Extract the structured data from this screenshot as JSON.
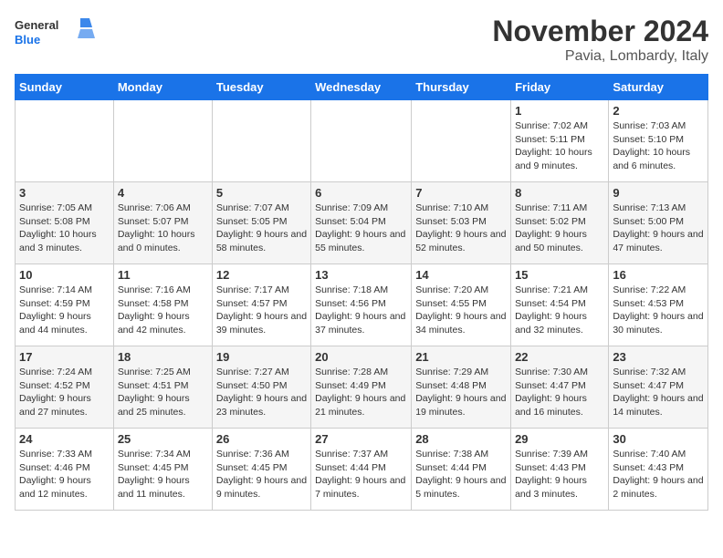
{
  "header": {
    "logo_line1": "General",
    "logo_line2": "Blue",
    "month_year": "November 2024",
    "location": "Pavia, Lombardy, Italy"
  },
  "weekdays": [
    "Sunday",
    "Monday",
    "Tuesday",
    "Wednesday",
    "Thursday",
    "Friday",
    "Saturday"
  ],
  "weeks": [
    [
      {
        "day": "",
        "info": ""
      },
      {
        "day": "",
        "info": ""
      },
      {
        "day": "",
        "info": ""
      },
      {
        "day": "",
        "info": ""
      },
      {
        "day": "",
        "info": ""
      },
      {
        "day": "1",
        "info": "Sunrise: 7:02 AM\nSunset: 5:11 PM\nDaylight: 10 hours and 9 minutes."
      },
      {
        "day": "2",
        "info": "Sunrise: 7:03 AM\nSunset: 5:10 PM\nDaylight: 10 hours and 6 minutes."
      }
    ],
    [
      {
        "day": "3",
        "info": "Sunrise: 7:05 AM\nSunset: 5:08 PM\nDaylight: 10 hours and 3 minutes."
      },
      {
        "day": "4",
        "info": "Sunrise: 7:06 AM\nSunset: 5:07 PM\nDaylight: 10 hours and 0 minutes."
      },
      {
        "day": "5",
        "info": "Sunrise: 7:07 AM\nSunset: 5:05 PM\nDaylight: 9 hours and 58 minutes."
      },
      {
        "day": "6",
        "info": "Sunrise: 7:09 AM\nSunset: 5:04 PM\nDaylight: 9 hours and 55 minutes."
      },
      {
        "day": "7",
        "info": "Sunrise: 7:10 AM\nSunset: 5:03 PM\nDaylight: 9 hours and 52 minutes."
      },
      {
        "day": "8",
        "info": "Sunrise: 7:11 AM\nSunset: 5:02 PM\nDaylight: 9 hours and 50 minutes."
      },
      {
        "day": "9",
        "info": "Sunrise: 7:13 AM\nSunset: 5:00 PM\nDaylight: 9 hours and 47 minutes."
      }
    ],
    [
      {
        "day": "10",
        "info": "Sunrise: 7:14 AM\nSunset: 4:59 PM\nDaylight: 9 hours and 44 minutes."
      },
      {
        "day": "11",
        "info": "Sunrise: 7:16 AM\nSunset: 4:58 PM\nDaylight: 9 hours and 42 minutes."
      },
      {
        "day": "12",
        "info": "Sunrise: 7:17 AM\nSunset: 4:57 PM\nDaylight: 9 hours and 39 minutes."
      },
      {
        "day": "13",
        "info": "Sunrise: 7:18 AM\nSunset: 4:56 PM\nDaylight: 9 hours and 37 minutes."
      },
      {
        "day": "14",
        "info": "Sunrise: 7:20 AM\nSunset: 4:55 PM\nDaylight: 9 hours and 34 minutes."
      },
      {
        "day": "15",
        "info": "Sunrise: 7:21 AM\nSunset: 4:54 PM\nDaylight: 9 hours and 32 minutes."
      },
      {
        "day": "16",
        "info": "Sunrise: 7:22 AM\nSunset: 4:53 PM\nDaylight: 9 hours and 30 minutes."
      }
    ],
    [
      {
        "day": "17",
        "info": "Sunrise: 7:24 AM\nSunset: 4:52 PM\nDaylight: 9 hours and 27 minutes."
      },
      {
        "day": "18",
        "info": "Sunrise: 7:25 AM\nSunset: 4:51 PM\nDaylight: 9 hours and 25 minutes."
      },
      {
        "day": "19",
        "info": "Sunrise: 7:27 AM\nSunset: 4:50 PM\nDaylight: 9 hours and 23 minutes."
      },
      {
        "day": "20",
        "info": "Sunrise: 7:28 AM\nSunset: 4:49 PM\nDaylight: 9 hours and 21 minutes."
      },
      {
        "day": "21",
        "info": "Sunrise: 7:29 AM\nSunset: 4:48 PM\nDaylight: 9 hours and 19 minutes."
      },
      {
        "day": "22",
        "info": "Sunrise: 7:30 AM\nSunset: 4:47 PM\nDaylight: 9 hours and 16 minutes."
      },
      {
        "day": "23",
        "info": "Sunrise: 7:32 AM\nSunset: 4:47 PM\nDaylight: 9 hours and 14 minutes."
      }
    ],
    [
      {
        "day": "24",
        "info": "Sunrise: 7:33 AM\nSunset: 4:46 PM\nDaylight: 9 hours and 12 minutes."
      },
      {
        "day": "25",
        "info": "Sunrise: 7:34 AM\nSunset: 4:45 PM\nDaylight: 9 hours and 11 minutes."
      },
      {
        "day": "26",
        "info": "Sunrise: 7:36 AM\nSunset: 4:45 PM\nDaylight: 9 hours and 9 minutes."
      },
      {
        "day": "27",
        "info": "Sunrise: 7:37 AM\nSunset: 4:44 PM\nDaylight: 9 hours and 7 minutes."
      },
      {
        "day": "28",
        "info": "Sunrise: 7:38 AM\nSunset: 4:44 PM\nDaylight: 9 hours and 5 minutes."
      },
      {
        "day": "29",
        "info": "Sunrise: 7:39 AM\nSunset: 4:43 PM\nDaylight: 9 hours and 3 minutes."
      },
      {
        "day": "30",
        "info": "Sunrise: 7:40 AM\nSunset: 4:43 PM\nDaylight: 9 hours and 2 minutes."
      }
    ]
  ]
}
